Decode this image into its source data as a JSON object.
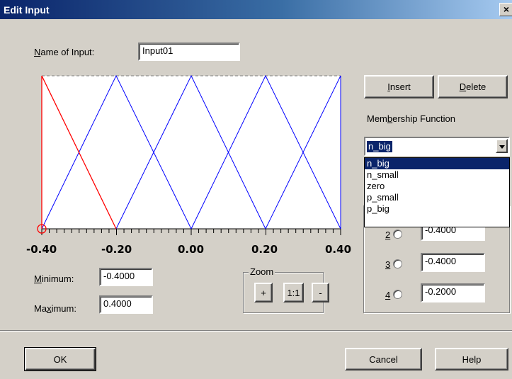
{
  "window": {
    "title": "Edit Input",
    "close_glyph": "×"
  },
  "name_field": {
    "label_accel": "N",
    "label_rest": "ame of Input:",
    "value": "Input01"
  },
  "plot": {
    "x_ticks": [
      "-0.40",
      "-0.20",
      "0.00",
      "0.20",
      "0.40"
    ],
    "selected_color": "#ff0000",
    "other_color": "#0000ff"
  },
  "minimum": {
    "label_accel": "M",
    "label_rest": "inimum:",
    "value": "-0.4000"
  },
  "maximum": {
    "label_pre": "Ma",
    "label_accel": "x",
    "label_rest": "imum:",
    "value": "0.4000"
  },
  "zoom": {
    "title": "Zoom",
    "plus": "+",
    "reset": "1:1",
    "minus": "-"
  },
  "insert_button": {
    "accel": "I",
    "rest": "nsert"
  },
  "delete_button": {
    "accel": "D",
    "rest": "elete"
  },
  "membership": {
    "label_pre": "Mem",
    "label_accel": "b",
    "label_rest": "ership Function",
    "selected": "n_big",
    "options": [
      "n_big",
      "n_small",
      "zero",
      "p_small",
      "p_big"
    ]
  },
  "points": [
    {
      "label": "2",
      "value": "-0.4000"
    },
    {
      "label": "3",
      "value": "-0.4000"
    },
    {
      "label": "4",
      "value": "-0.2000"
    }
  ],
  "footer": {
    "ok": "OK",
    "cancel": "Cancel",
    "help": "Help"
  }
}
